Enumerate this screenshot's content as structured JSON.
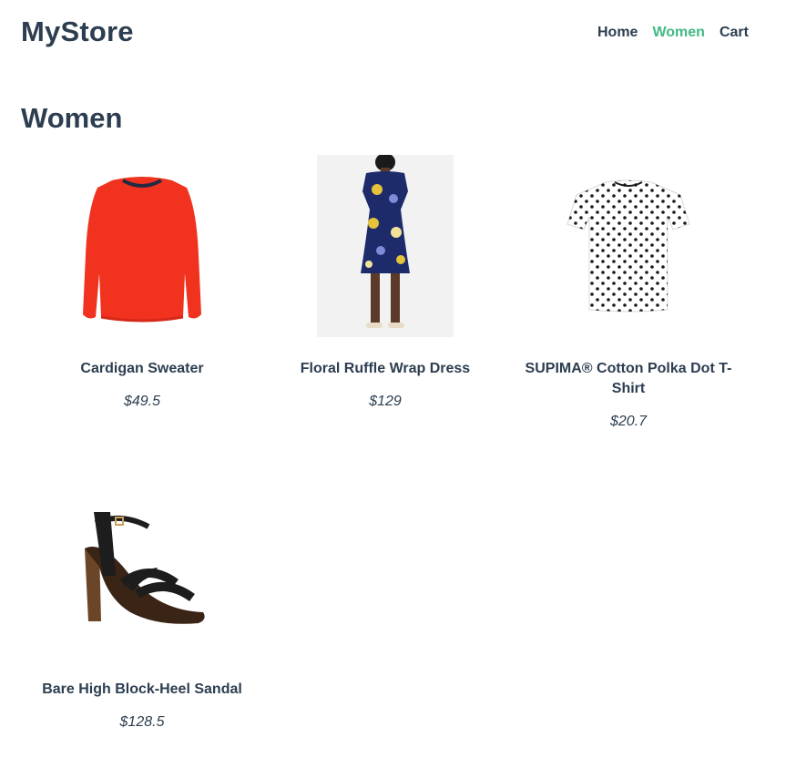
{
  "brand": {
    "name": "MyStore"
  },
  "nav": {
    "items": [
      {
        "label": "Home",
        "active": false
      },
      {
        "label": "Women",
        "active": true
      },
      {
        "label": "Cart",
        "active": false
      }
    ],
    "active_color": "#42b983",
    "text_color": "#2c3e50"
  },
  "page": {
    "title": "Women"
  },
  "products": [
    {
      "name": "Cardigan Sweater",
      "price": "$49.5",
      "image_icon": "red-sweater-image"
    },
    {
      "name": "Floral Ruffle Wrap Dress",
      "price": "$129",
      "image_icon": "floral-dress-image"
    },
    {
      "name": "SUPIMA® Cotton Polka Dot T-Shirt",
      "price": "$20.7",
      "image_icon": "polka-dot-tshirt-image"
    },
    {
      "name": "Bare High Block-Heel Sandal",
      "price": "$128.5",
      "image_icon": "block-heel-sandal-image"
    }
  ]
}
